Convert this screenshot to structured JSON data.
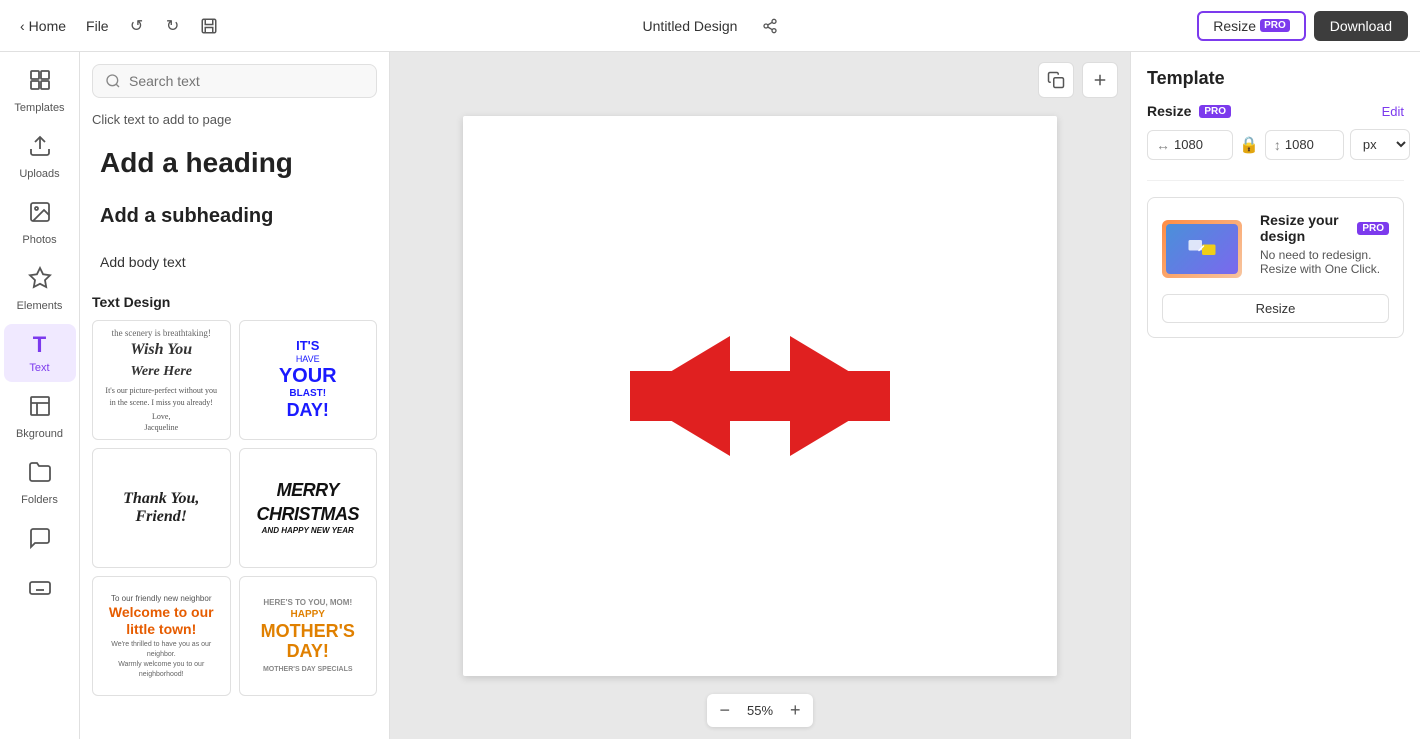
{
  "topbar": {
    "home_label": "Home",
    "file_label": "File",
    "design_title": "Untitled Design",
    "resize_label": "Resize",
    "pro_badge": "PRO",
    "download_label": "Download"
  },
  "sidebar": {
    "items": [
      {
        "id": "templates",
        "label": "Templates",
        "icon": "⊞"
      },
      {
        "id": "uploads",
        "label": "Uploads",
        "icon": "↑"
      },
      {
        "id": "photos",
        "label": "Photos",
        "icon": "🖼"
      },
      {
        "id": "elements",
        "label": "Elements",
        "icon": "✦"
      },
      {
        "id": "text",
        "label": "Text",
        "icon": "T",
        "active": true
      },
      {
        "id": "background",
        "label": "Bkground",
        "icon": "▦"
      },
      {
        "id": "folders",
        "label": "Folders",
        "icon": "📁"
      },
      {
        "id": "speech",
        "label": "",
        "icon": "💬"
      },
      {
        "id": "keyboard",
        "label": "",
        "icon": "⌨"
      }
    ]
  },
  "left_panel": {
    "search_placeholder": "Search text",
    "click_to_add": "Click text to add to page",
    "add_heading": "Add a heading",
    "add_subheading": "Add a subheading",
    "add_body": "Add body text",
    "text_design_label": "Text Design",
    "designs": [
      {
        "id": "wish-you",
        "type": "wish-you-were-here"
      },
      {
        "id": "its-your-day",
        "type": "its-your-day"
      },
      {
        "id": "thank-you-friend",
        "type": "thank-you-friend"
      },
      {
        "id": "merry-christmas",
        "type": "merry-christmas"
      },
      {
        "id": "welcome-town",
        "type": "welcome-town"
      },
      {
        "id": "happy-mothers",
        "type": "happy-mothers-day"
      }
    ]
  },
  "canvas": {
    "zoom_level": "55%",
    "zoom_minus": "−",
    "zoom_plus": "+"
  },
  "right_panel": {
    "title": "Template",
    "resize_label": "Resize",
    "pro_badge": "PRO",
    "edit_label": "Edit",
    "width_value": "1080",
    "height_value": "1080",
    "unit": "px",
    "resize_promo_title": "Resize your design",
    "resize_promo_pro": "PRO",
    "resize_promo_desc": "No need to redesign. Resize with One Click.",
    "resize_promo_btn": "Resize"
  }
}
